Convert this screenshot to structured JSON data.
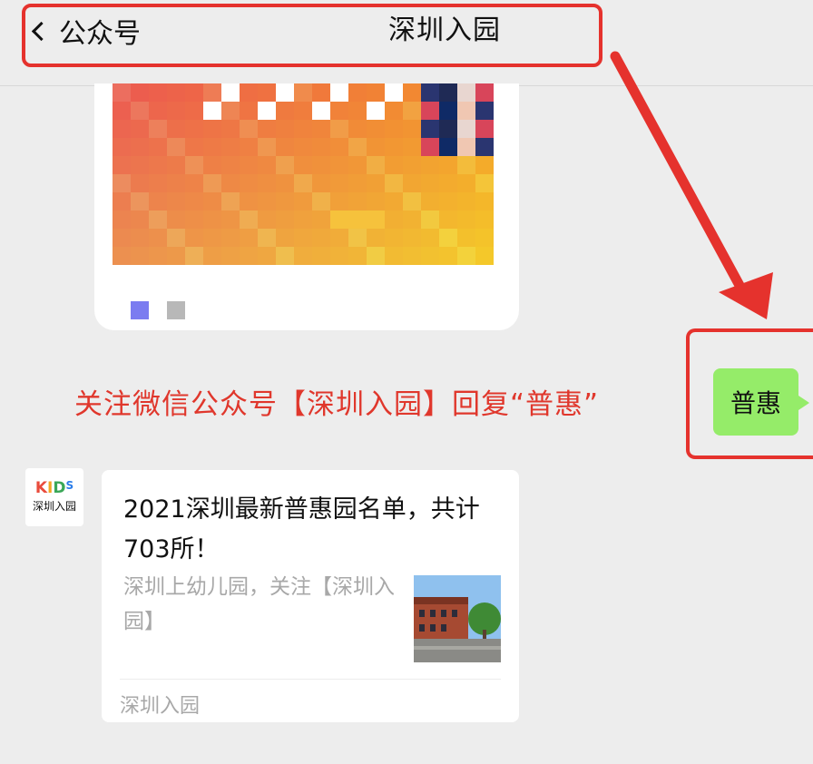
{
  "header": {
    "back_label": "公众号",
    "title": "深圳入园"
  },
  "notice": "关注微信公众号【深圳入园】回复“普惠”",
  "reply_bubble": "普惠",
  "account": {
    "logo_k": "K",
    "logo_i": "I",
    "logo_d": "D",
    "logo_s": "S",
    "name": "深圳入园"
  },
  "article": {
    "title": "2021深圳最新普惠园名单，共计703所！",
    "description": "深圳上幼儿园，关注【深圳入园】",
    "source": "深圳入园"
  },
  "colors": {
    "highlight_red": "#e5322d",
    "notice_red": "#e0372c",
    "bubble_green": "#95ec69"
  },
  "icons": [
    "chevron-left-icon",
    "red-arrow-icon"
  ]
}
